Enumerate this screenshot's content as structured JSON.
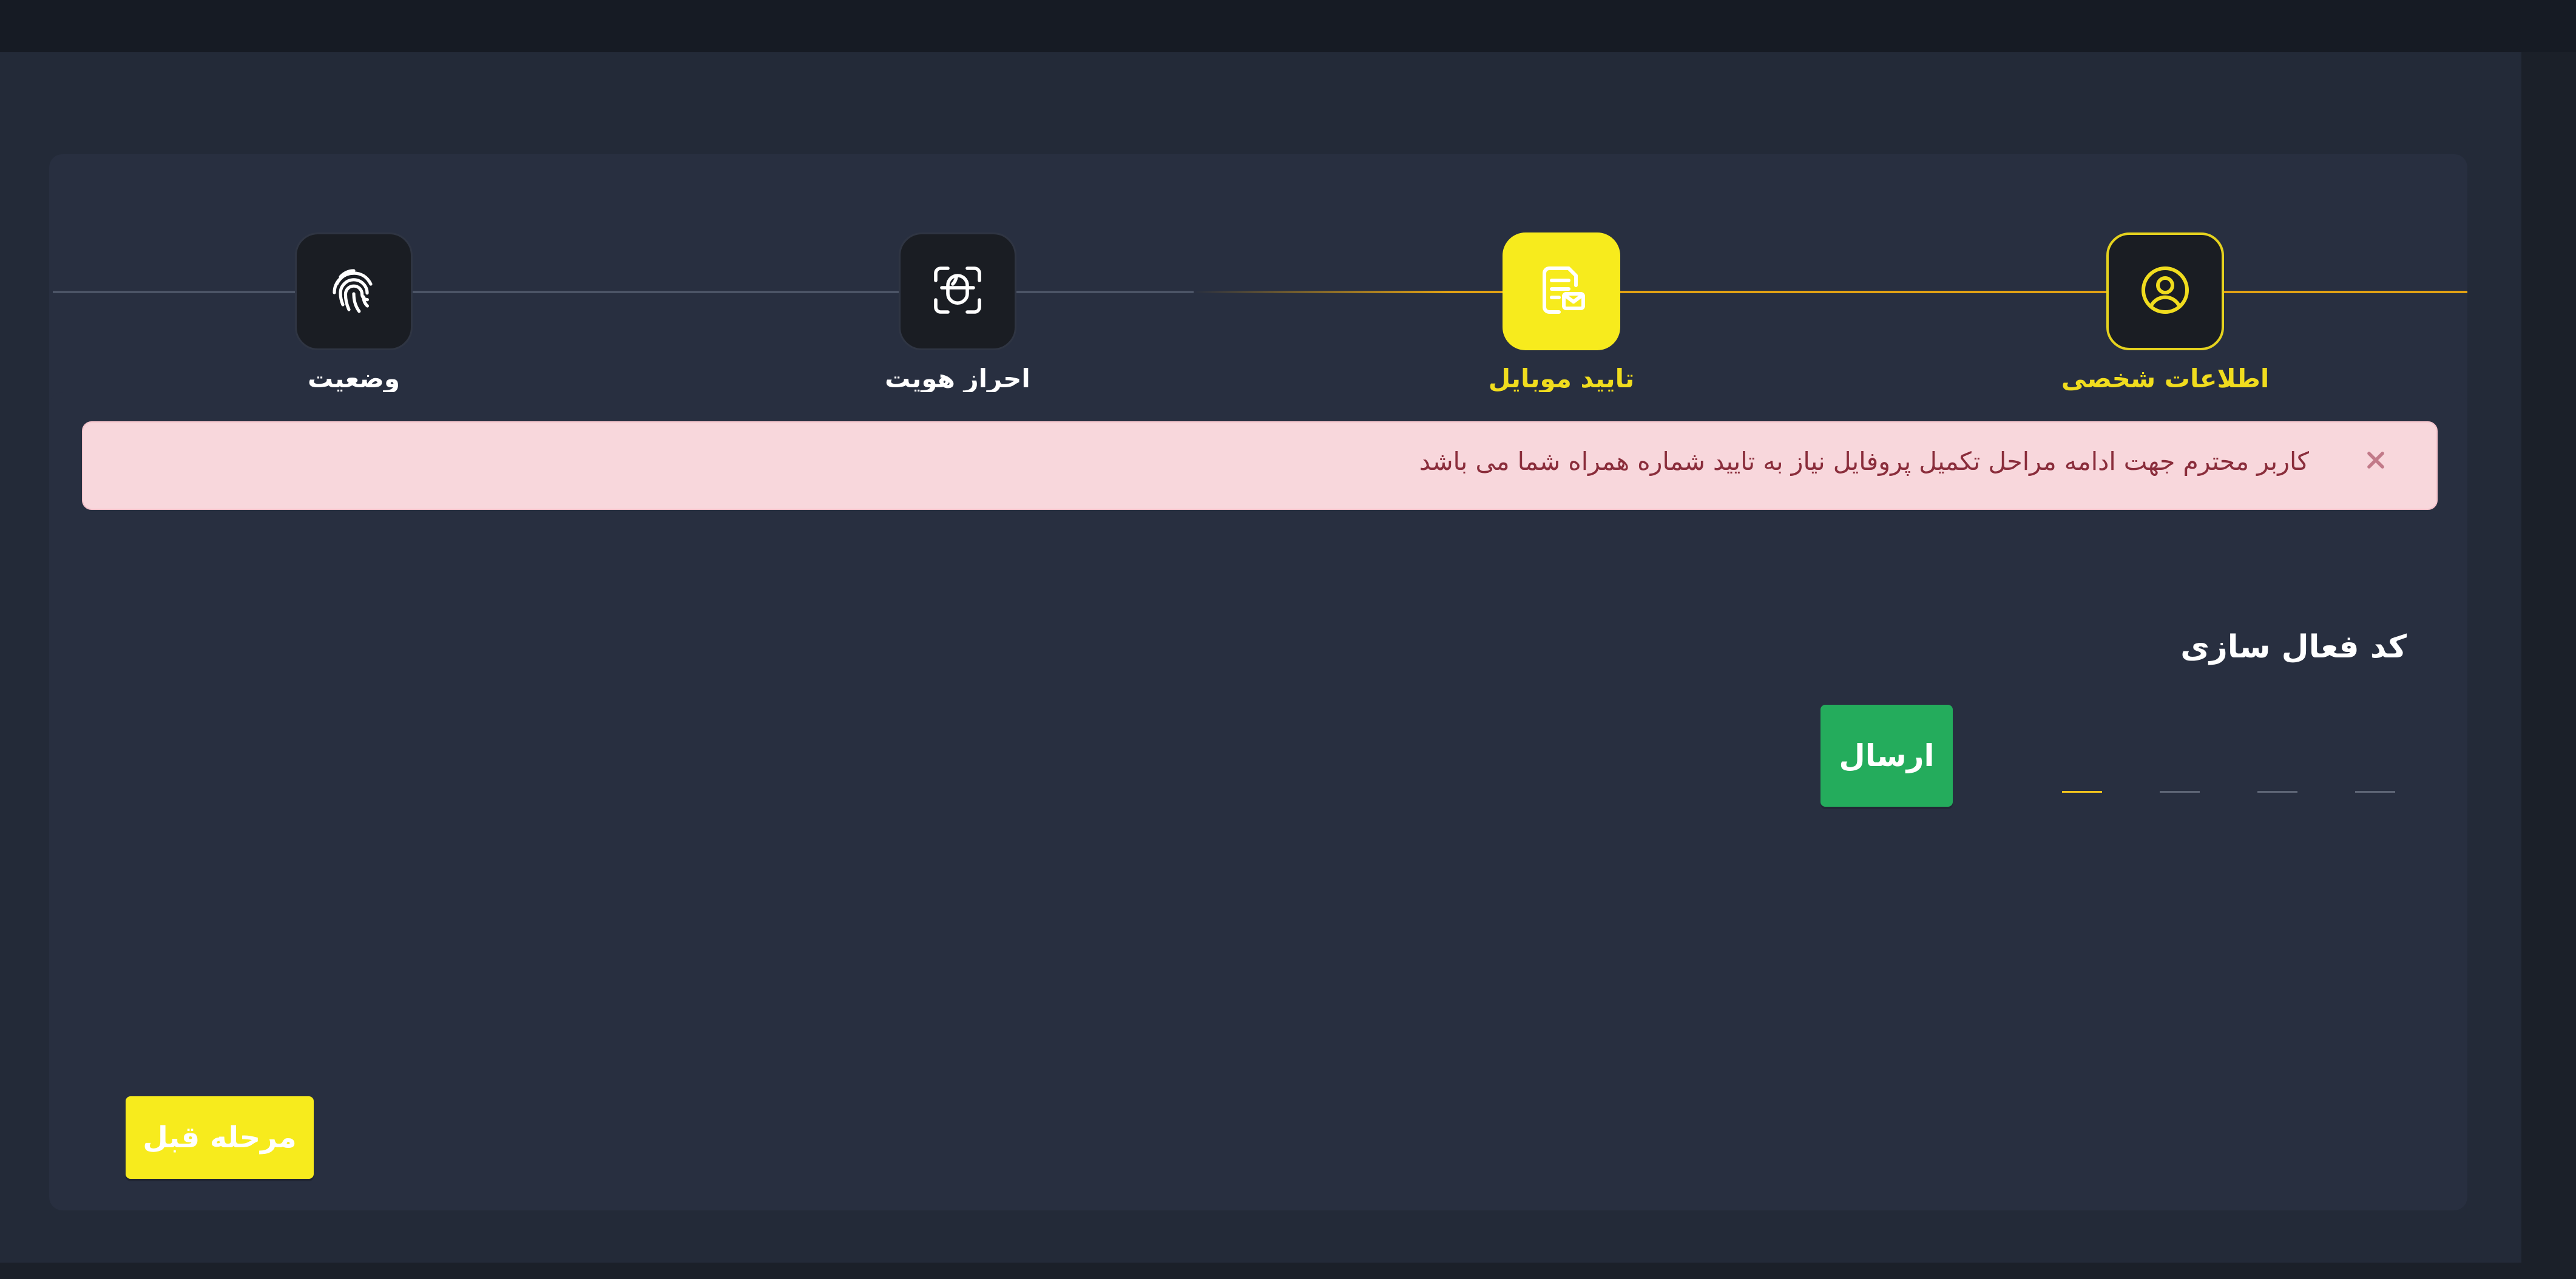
{
  "stepper": {
    "steps": [
      {
        "label": "اطلاعات شخصی",
        "icon": "user-circle-icon",
        "state": "done"
      },
      {
        "label": "تایید موبایل",
        "icon": "document-message-icon",
        "state": "active"
      },
      {
        "label": "احراز هویت",
        "icon": "face-scan-icon",
        "state": "pending"
      },
      {
        "label": "وضعیت",
        "icon": "fingerprint-icon",
        "state": "pending"
      }
    ]
  },
  "alert": {
    "message": "کاربر محترم جهت ادامه مراحل تکمیل پروفایل نیاز به تایید شماره همراه شما می باشد",
    "close_icon": "close-icon"
  },
  "activation": {
    "title": "کد فعال سازی",
    "send_label": "ارسال",
    "code_digits": [
      "",
      "",
      "",
      ""
    ]
  },
  "footer": {
    "prev_label": "مرحله قبل"
  },
  "colors": {
    "accent_yellow": "#f7eb1d",
    "gold_line": "#e2a214",
    "success_green": "#24ac5c",
    "alert_bg": "#f8d7dc",
    "alert_text": "#8a2d3b"
  }
}
